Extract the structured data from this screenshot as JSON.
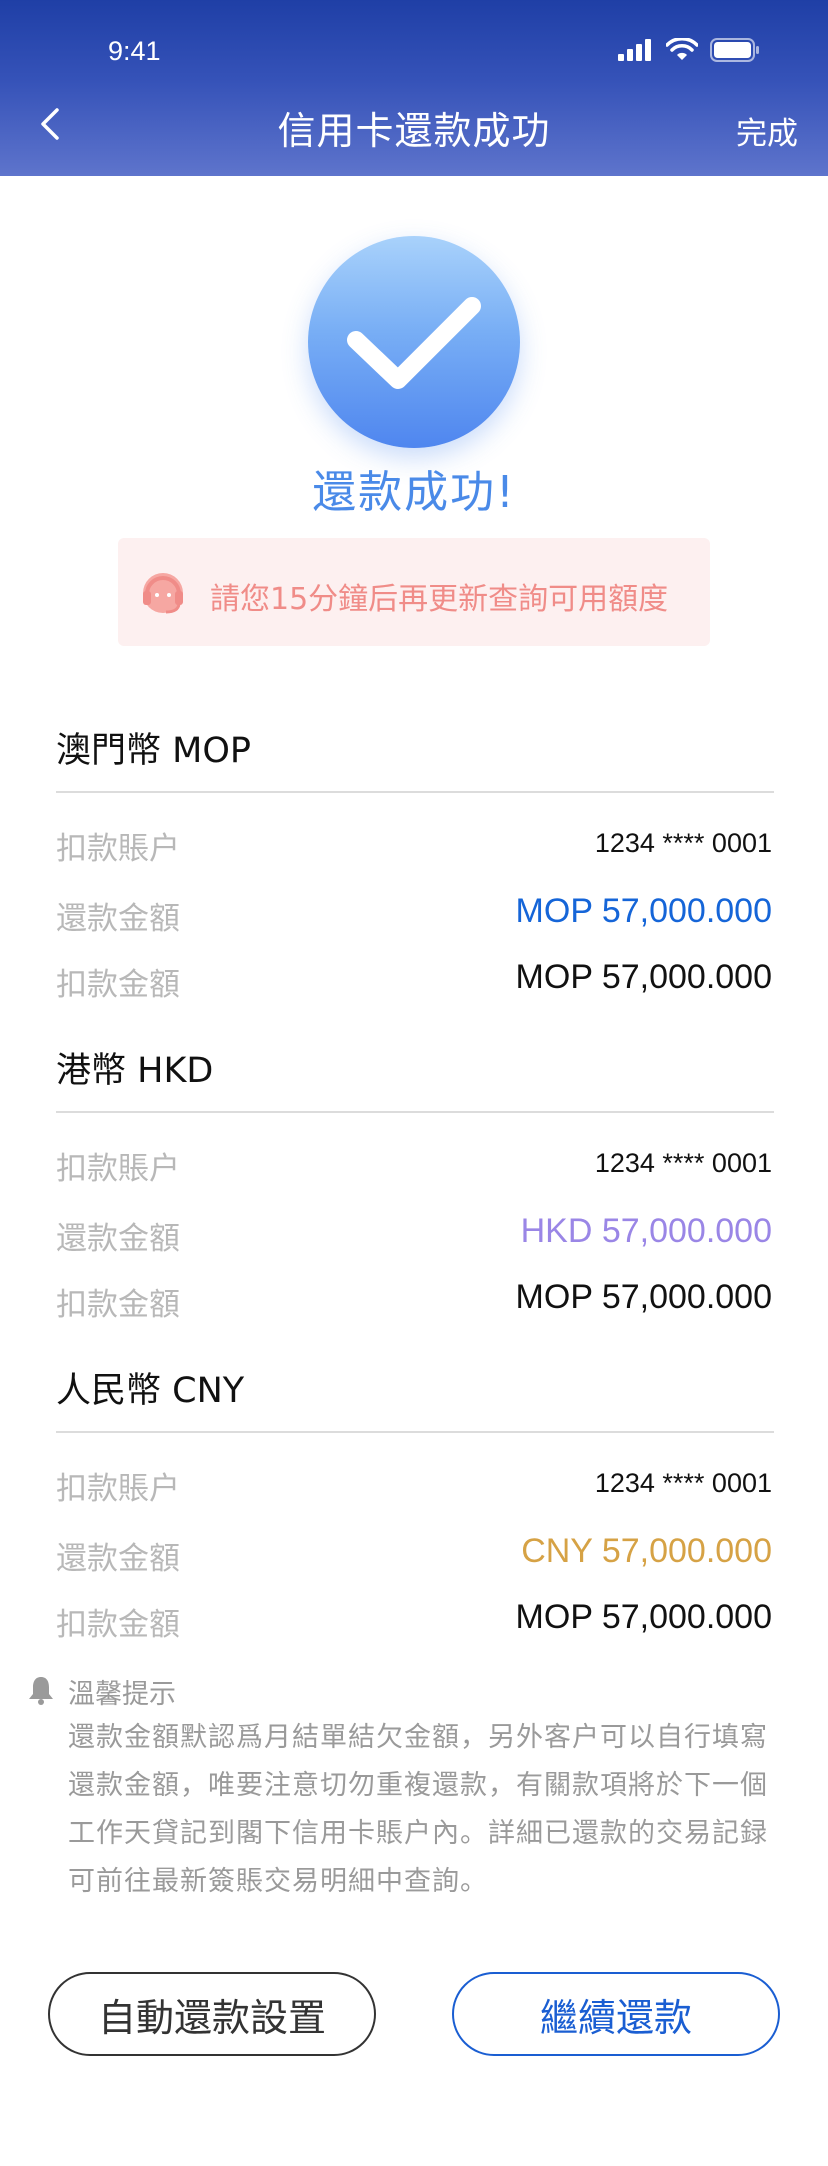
{
  "status_bar": {
    "time": "9:41"
  },
  "nav": {
    "title": "信用卡還款成功",
    "done_label": "完成"
  },
  "result": {
    "title": "還款成功!"
  },
  "notice": {
    "text": "請您15分鐘后再更新查詢可用額度"
  },
  "sections": [
    {
      "title": "澳門幣 MOP",
      "rows": [
        {
          "label": "扣款賬户",
          "value": "1234 **** 0001"
        },
        {
          "label": "還款金額",
          "value": "MOP 57,000.000",
          "color": "#1565d8"
        },
        {
          "label": "扣款金額",
          "value": "MOP 57,000.000"
        }
      ]
    },
    {
      "title": "港幣 HKD",
      "rows": [
        {
          "label": "扣款賬户",
          "value": "1234 **** 0001"
        },
        {
          "label": "還款金額",
          "value": "HKD 57,000.000",
          "color": "#9a86e6"
        },
        {
          "label": "扣款金額",
          "value": "MOP 57,000.000"
        }
      ]
    },
    {
      "title": "人民幣 CNY",
      "rows": [
        {
          "label": "扣款賬户",
          "value": "1234 **** 0001"
        },
        {
          "label": "還款金額",
          "value": "CNY 57,000.000",
          "color": "#d6a245"
        },
        {
          "label": "扣款金額",
          "value": "MOP 57,000.000"
        }
      ]
    }
  ],
  "tips": {
    "title": "溫馨提示",
    "body": "還款金額默認爲月結單結欠金額，另外客户可以自行填寫還款金額，唯要注意切勿重複還款，有關款項將於下一個工作天貸記到閣下信用卡賬户內。詳細已還款的交易記録可前往最新簽賬交易明細中查詢。"
  },
  "buttons": {
    "auto_label": "自動還款設置",
    "continue_label": "繼續還款"
  },
  "icons": [
    "signal-icon",
    "wifi-icon",
    "battery-icon",
    "back-chevron-icon",
    "checkmark-icon",
    "headset-icon",
    "bell-icon"
  ]
}
